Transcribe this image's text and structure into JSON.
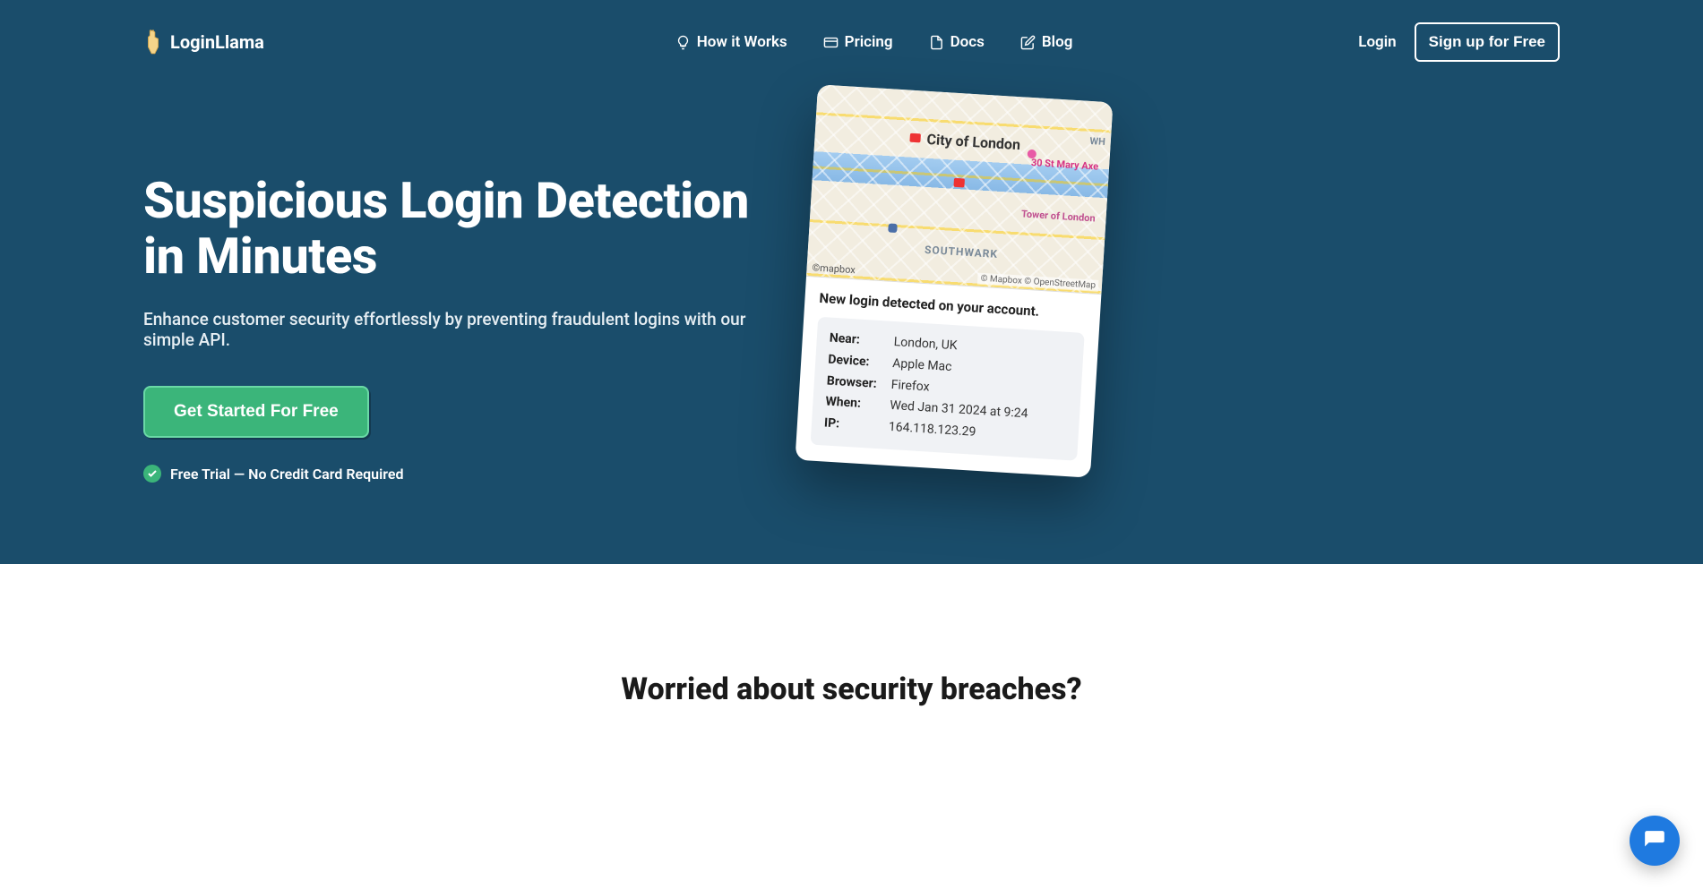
{
  "brand": {
    "name": "LoginLlama"
  },
  "nav": {
    "how_it_works": "How it Works",
    "pricing": "Pricing",
    "docs": "Docs",
    "blog": "Blog",
    "login": "Login",
    "signup": "Sign up for Free"
  },
  "hero": {
    "title_line1": "Suspicious Login Detection",
    "title_line2": "in Minutes",
    "subtitle": "Enhance customer security effortlessly by preventing fraudulent logins with our simple API.",
    "cta": "Get Started For Free",
    "trial_note": "Free Trial — No Credit Card Required"
  },
  "card": {
    "title": "New login detected on your account.",
    "rows": [
      {
        "key": "Near:",
        "val": "London, UK"
      },
      {
        "key": "Device:",
        "val": "Apple Mac"
      },
      {
        "key": "Browser:",
        "val": "Firefox"
      },
      {
        "key": "When:",
        "val": "Wed Jan 31 2024 at 9:24"
      },
      {
        "key": "IP:",
        "val": "164.118.123.29"
      }
    ],
    "map": {
      "city": "City of London",
      "axe": "30 St Mary Axe",
      "tower": "Tower of London",
      "southwark": "SOUTHWARK",
      "wh": "WH",
      "logo": "©mapbox",
      "attr": "© Mapbox © OpenStreetMap"
    }
  },
  "section2": {
    "heading": "Worried about security breaches?"
  }
}
